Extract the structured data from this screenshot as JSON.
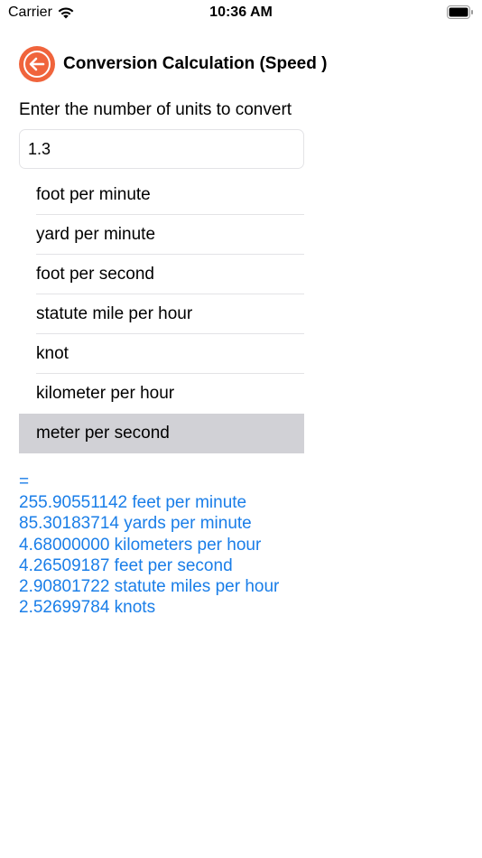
{
  "status_bar": {
    "carrier": "Carrier",
    "time": "10:36 AM",
    "icons": [
      "wifi-icon",
      "battery-icon"
    ]
  },
  "header": {
    "back_icon": "back-arrow-icon",
    "title": "Conversion Calculation (Speed )"
  },
  "prompt": "Enter the number of units to convert",
  "input": {
    "value": "1.3",
    "placeholder": ""
  },
  "units": {
    "items": [
      {
        "label": "foot per minute"
      },
      {
        "label": "yard per minute"
      },
      {
        "label": "foot per second"
      },
      {
        "label": "statute mile per hour"
      },
      {
        "label": "knot"
      },
      {
        "label": "kilometer per hour"
      },
      {
        "label": "meter per second"
      }
    ],
    "selected_index": 6
  },
  "results": {
    "equals": "=",
    "lines": [
      "255.90551142 feet per minute",
      "85.30183714 yards per minute",
      "4.68000000 kilometers per hour",
      "4.26509187 feet per second",
      "2.90801722 statute miles per hour",
      "2.52699784 knots"
    ]
  },
  "colors": {
    "accent_orange": "#f0643c",
    "result_blue": "#1a7ee8",
    "selected_row": "#d1d1d6"
  }
}
